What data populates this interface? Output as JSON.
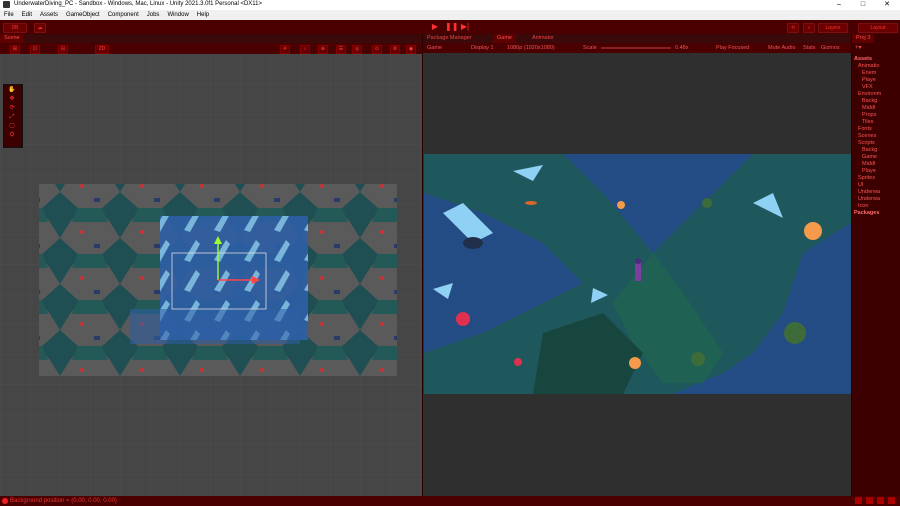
{
  "window": {
    "title": "UnderwaterDiving_PC - Sandbox - Windows, Mac, Linux - Unity 2021.3.0f1 Personal <DX11>",
    "controls": [
      "–",
      "□",
      "✕"
    ]
  },
  "menu": [
    "File",
    "Edit",
    "Assets",
    "GameObject",
    "Component",
    "Jobs",
    "Window",
    "Help"
  ],
  "toolbar": {
    "account_label": "DB",
    "layers_label": "Layers",
    "layout_label": "Layout",
    "play_icons": [
      "▶",
      "❚❚",
      "▶|"
    ]
  },
  "scene": {
    "tab_label": "Scene",
    "toolbar_items": [
      "⊞",
      "⊡",
      "⊟",
      "2D",
      "☀",
      "♪",
      "⊕",
      "☰",
      "◎",
      "⊙",
      "⚙",
      "◉"
    ]
  },
  "tools": [
    "✋",
    "✥",
    "⟳",
    "⤢",
    "▢",
    "⛭"
  ],
  "game": {
    "tabs": [
      "Package Manager",
      "Game",
      "Animator"
    ],
    "active_tab": "Game",
    "display_mode": "Game",
    "display": "Display 1",
    "resolution": "1080p (1920x1080)",
    "scale_label": "Scale",
    "scale_value": "0.48x",
    "play_mode": "Play Focused",
    "mute": "Mute Audio",
    "stats": "Stats",
    "gizmos": "Gizmos"
  },
  "project": {
    "tab_label": "Proj",
    "count": "3",
    "items": [
      {
        "label": "Assets",
        "bold": true
      },
      {
        "label": "Animatio",
        "bold": false
      },
      {
        "label": "Enem",
        "bold": false
      },
      {
        "label": "Playe",
        "bold": false
      },
      {
        "label": "VFX",
        "bold": false
      },
      {
        "label": "Environm",
        "bold": false
      },
      {
        "label": "Backg",
        "bold": false
      },
      {
        "label": "Middl",
        "bold": false
      },
      {
        "label": "Props",
        "bold": false
      },
      {
        "label": "Tiles",
        "bold": false
      },
      {
        "label": "Fonts",
        "bold": false
      },
      {
        "label": "Scenes",
        "bold": false
      },
      {
        "label": "Scripts",
        "bold": false
      },
      {
        "label": "Backg",
        "bold": false
      },
      {
        "label": "Game",
        "bold": false
      },
      {
        "label": "Middl",
        "bold": false
      },
      {
        "label": "Playe",
        "bold": false
      },
      {
        "label": "Sprites",
        "bold": false
      },
      {
        "label": "UI",
        "bold": false
      },
      {
        "label": "Underwa",
        "bold": false
      },
      {
        "label": "Underwa",
        "bold": false
      },
      {
        "label": "Icon",
        "bold": false
      },
      {
        "label": "Packages",
        "bold": true
      }
    ]
  },
  "status": {
    "message": "Background position = (0.00, 0.00, 0.00)"
  },
  "colors": {
    "accent": "#ff3030",
    "panel": "#3a0a0a",
    "water": "#23456e",
    "rock": "#1f5a4f"
  }
}
